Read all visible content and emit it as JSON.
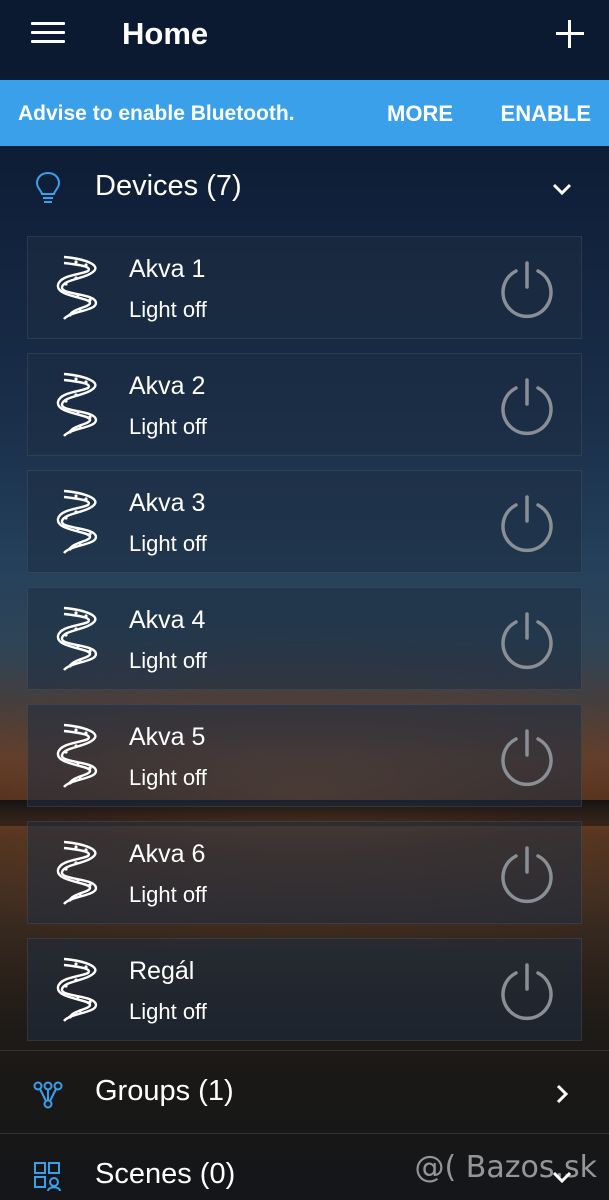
{
  "header": {
    "title": "Home",
    "menu_icon": "hamburger-menu-icon",
    "add_icon": "plus-icon"
  },
  "banner": {
    "message": "Advise to enable Bluetooth.",
    "more_label": "MORE",
    "enable_label": "ENABLE",
    "color": "#3aa0ea"
  },
  "sections": {
    "devices": {
      "label": "Devices (7)",
      "icon": "lightbulb-icon",
      "state": "expanded"
    },
    "groups": {
      "label": "Groups (1)",
      "icon": "group-nodes-icon",
      "state": "collapsed"
    },
    "scenes": {
      "label": "Scenes (0)",
      "icon": "scenes-grid-icon",
      "state": "expanded"
    }
  },
  "devices": [
    {
      "name": "Akva 1",
      "status": "Light off"
    },
    {
      "name": "Akva 2",
      "status": "Light off"
    },
    {
      "name": "Akva 3",
      "status": "Light off"
    },
    {
      "name": "Akva 4",
      "status": "Light off"
    },
    {
      "name": "Akva 5",
      "status": "Light off"
    },
    {
      "name": "Akva 6",
      "status": "Light off"
    },
    {
      "name": "Regál",
      "status": "Light off"
    }
  ],
  "watermark": "@( Bazos.sk"
}
